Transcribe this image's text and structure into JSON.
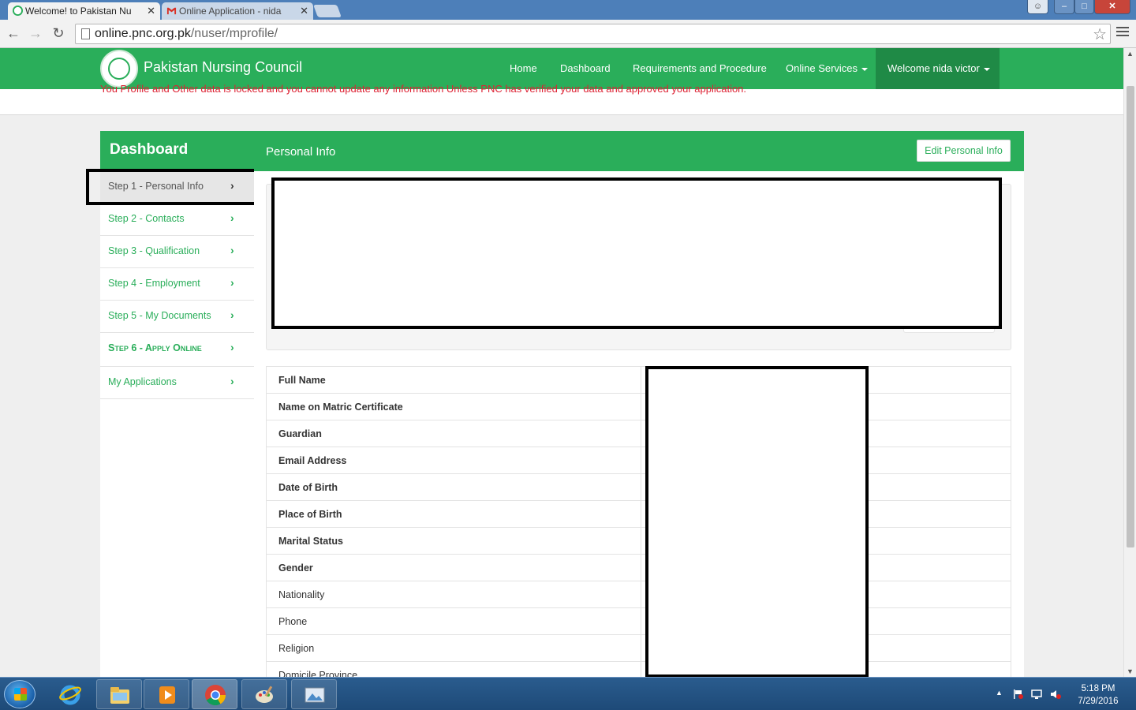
{
  "browser": {
    "tabs": [
      {
        "label": "Welcome! to Pakistan Nu",
        "close": "✕"
      },
      {
        "label": "Online Application - nida",
        "close": "✕"
      }
    ],
    "url_host": "online.pnc.org.pk",
    "url_path": "/nuser/mprofile/"
  },
  "navbar": {
    "brand": "Pakistan Nursing Council",
    "links": [
      "Home",
      "Dashboard",
      "Requirements and Procedure",
      "Online Services"
    ],
    "welcome": "Welcome nida victor"
  },
  "notice": "You Profile and Other data is locked and you cannot update any information Unless PNC has verified your data and approved your application.",
  "sidebar": {
    "title": "Dashboard",
    "items": [
      {
        "label": "Step 1 - Personal Info"
      },
      {
        "label": "Step 2 - Contacts"
      },
      {
        "label": "Step 3 - Qualification"
      },
      {
        "label": "Step 4 - Employment"
      },
      {
        "label": "Step 5 - My Documents"
      },
      {
        "label": "Step 6 - Apply Online"
      },
      {
        "label": "My Applications"
      }
    ],
    "chevron": "›"
  },
  "panel": {
    "title": "Personal Info",
    "edit_button": "Edit Personal Info"
  },
  "info_rows": [
    "Full Name",
    "Name on Matric Certificate",
    "Guardian",
    "Email Address",
    "Date of Birth",
    "Place of Birth",
    "Marital Status",
    "Gender",
    "Nationality",
    "Phone",
    "Religion",
    "Domicile Province"
  ],
  "taskbar": {
    "time": "5:18 PM",
    "date": "7/29/2016"
  },
  "colors": {
    "brand_green": "#2aae5a",
    "nav_active": "#1f8a46",
    "notice_red": "#dd2233"
  }
}
